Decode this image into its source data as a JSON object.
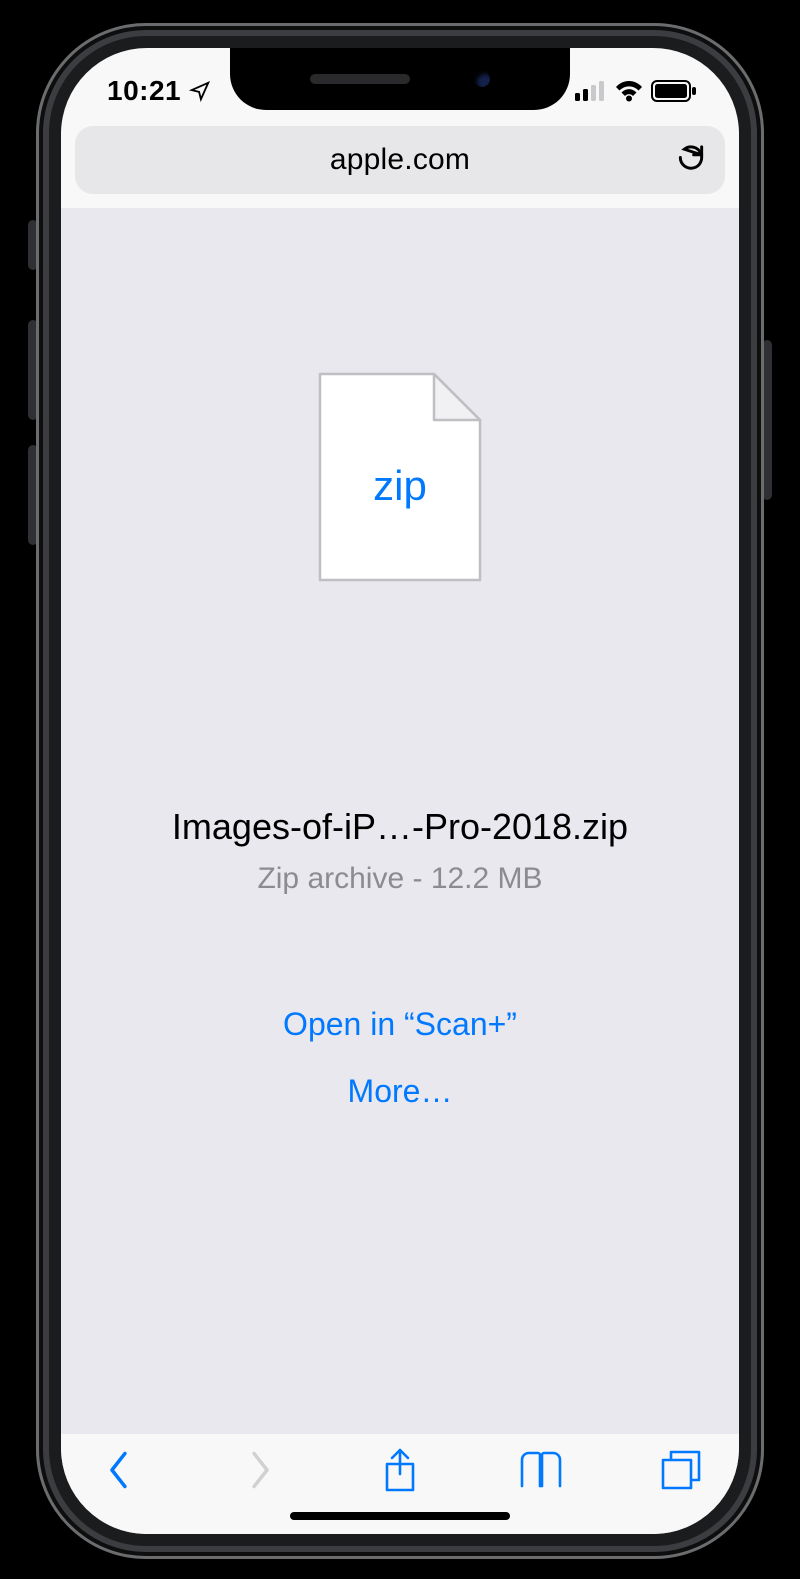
{
  "status": {
    "time": "10:21"
  },
  "address": {
    "domain": "apple.com"
  },
  "file": {
    "ext_label": "zip",
    "name": "Images-of-iP…-Pro-2018.zip",
    "meta": "Zip archive - 12.2 MB"
  },
  "actions": {
    "open_in": "Open in “Scan+”",
    "more": "More…"
  },
  "colors": {
    "accent": "#0079ff",
    "muted": "#8b8b90"
  }
}
